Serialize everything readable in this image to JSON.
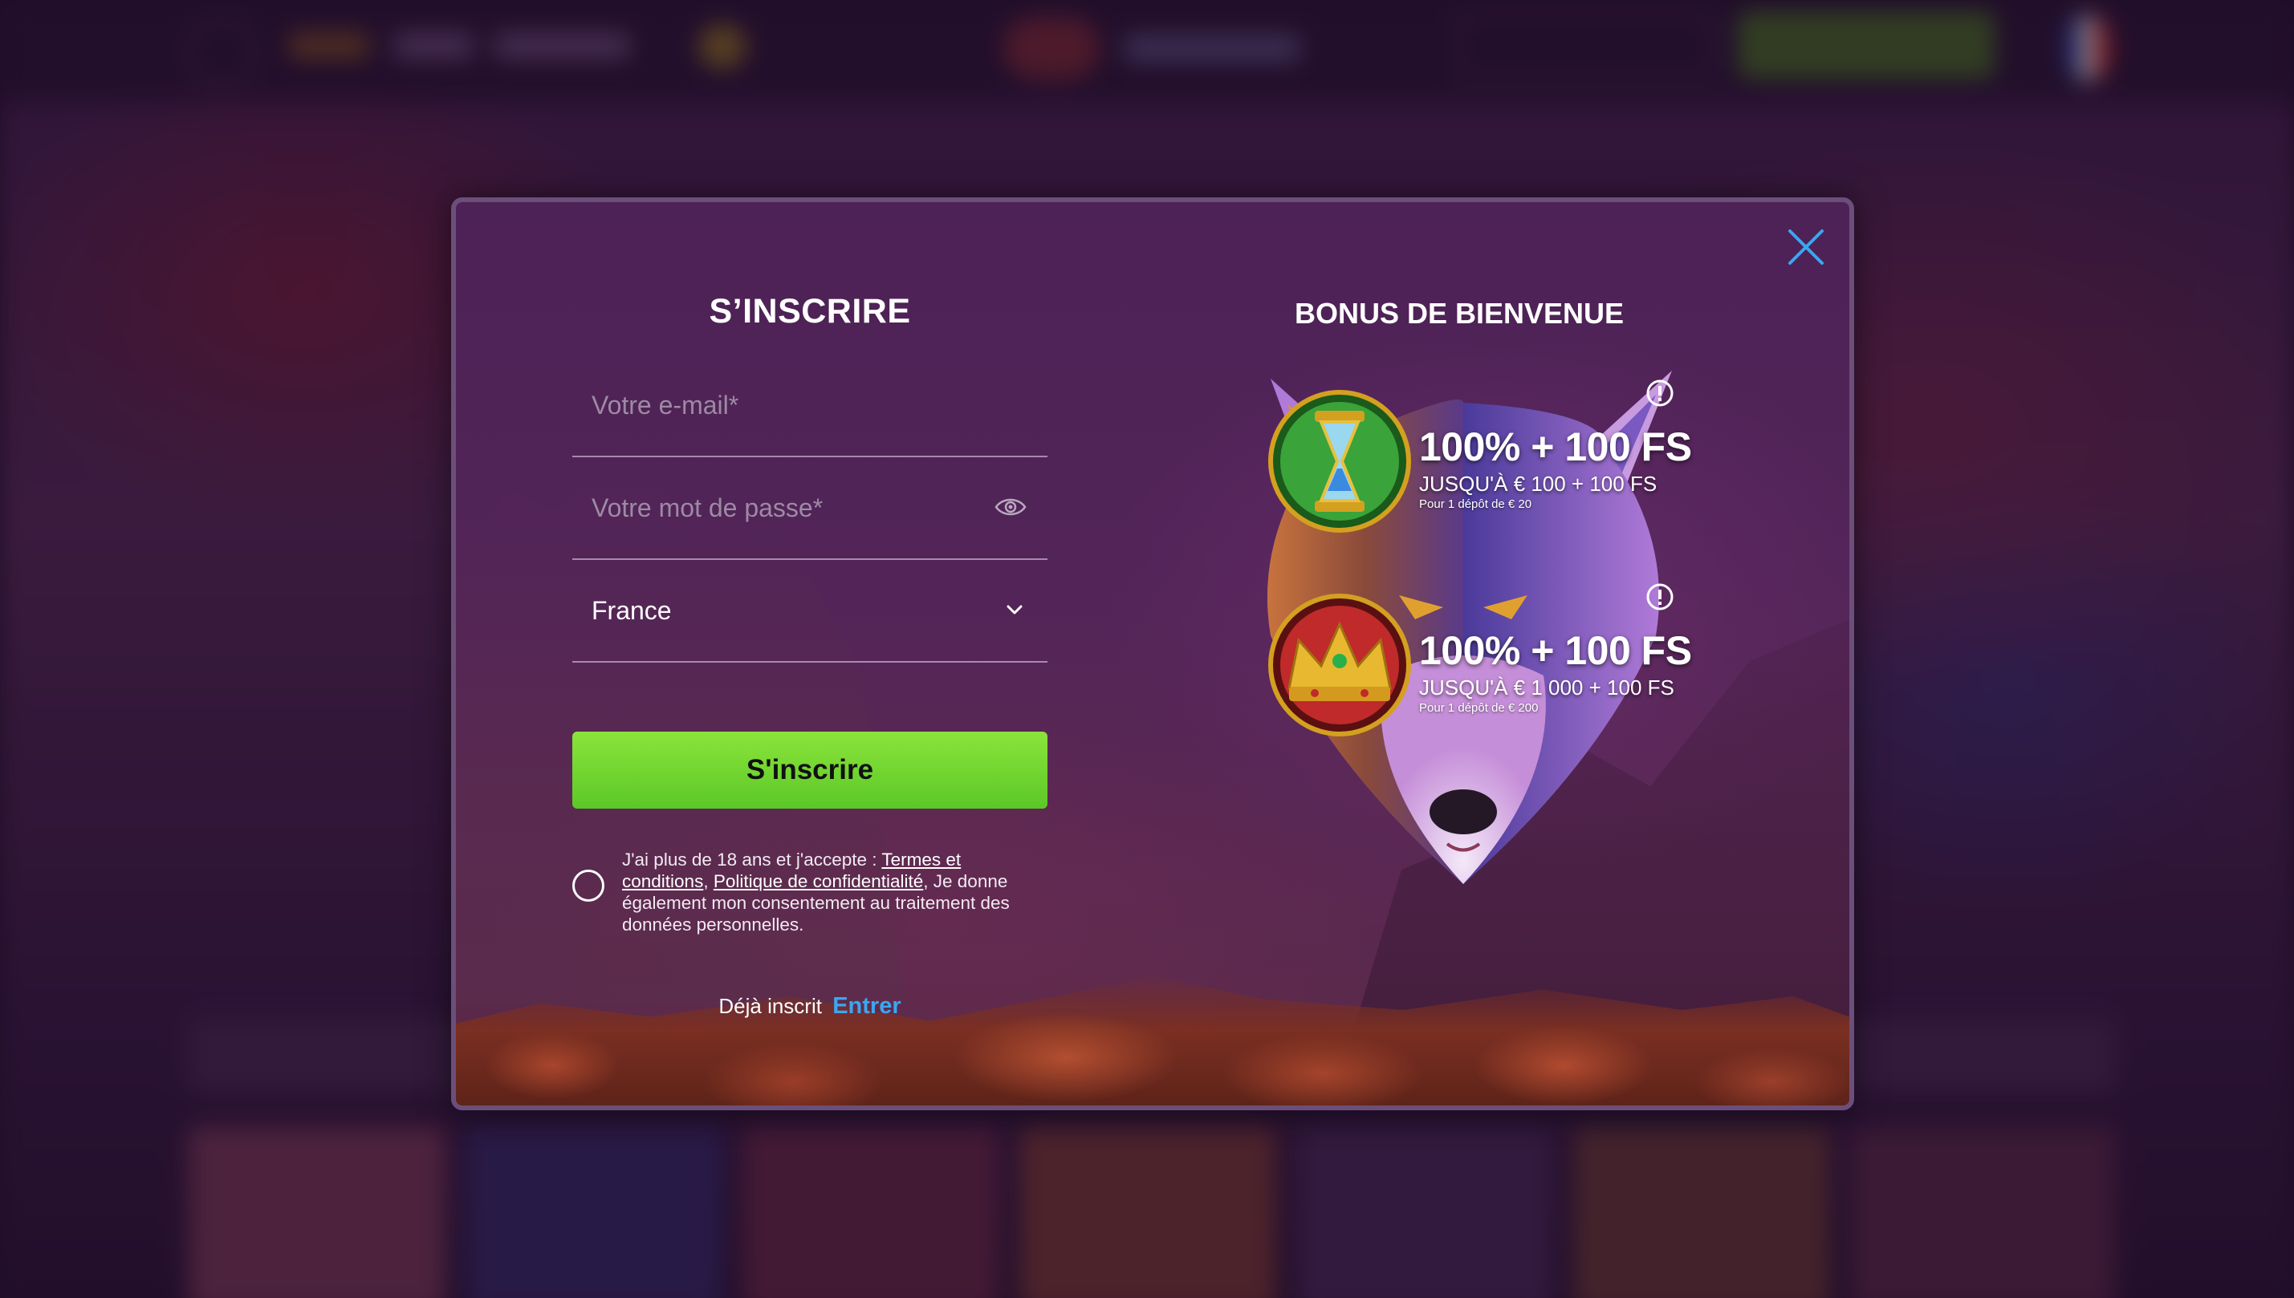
{
  "colors": {
    "modal_border": "#6b4f7a",
    "button_green": "#6fd32e",
    "link_blue": "#3ba7f0",
    "close_blue": "#3ba7f0"
  },
  "signup": {
    "title": "S’INSCRIRE",
    "email_placeholder": "Votre e-mail*",
    "password_placeholder": "Votre mot de passe*",
    "country_value": "France",
    "submit_label": "S'inscrire",
    "consent": {
      "text_before": "J'ai plus de 18 ans et j'accepte : ",
      "terms_link": "Termes et conditions",
      "separator": ", ",
      "privacy_link": "Politique de confidentialité",
      "text_after": ", Je donne également mon consentement au traitement des données personnelles."
    },
    "already_text": "Déjà inscrit",
    "login_link": "Entrer"
  },
  "bonus": {
    "title": "BONUS DE BIENVENUE",
    "offers": [
      {
        "main": "100% + 100 FS",
        "sub": "JUSQU'À € 100 + 100 FS",
        "small": "Pour 1 dépôt de € 20",
        "icon": "hourglass-medal-icon"
      },
      {
        "main": "100% + 100 FS",
        "sub": "JUSQU'À € 1 000 + 100 FS",
        "small": "Pour 1 dépôt de € 200",
        "icon": "crown-medal-icon"
      }
    ]
  }
}
